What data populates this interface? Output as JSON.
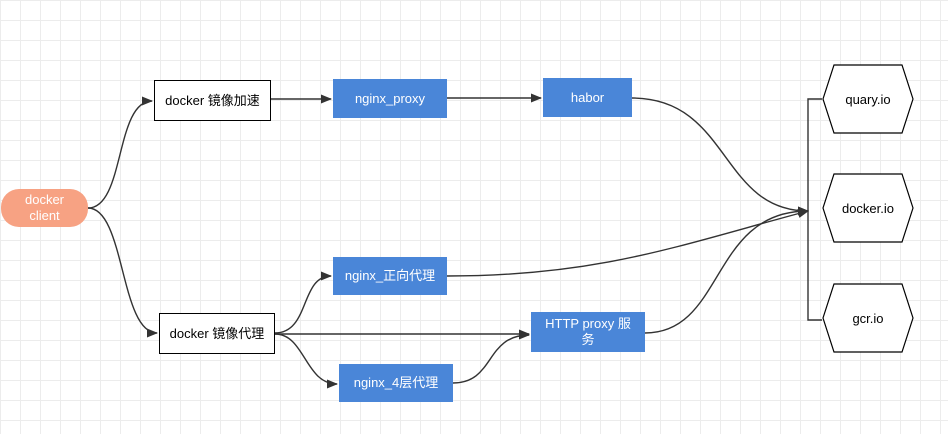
{
  "nodes": {
    "docker_client": "docker\nclient",
    "mirror_accel": "docker 镜像加速",
    "nginx_proxy": "nginx_proxy",
    "habor": "habor",
    "mirror_proxy": "docker 镜像代理",
    "nginx_forward": "nginx_正向代理",
    "http_proxy": "HTTP proxy 服务",
    "nginx_l4": "nginx_4层代理",
    "quay": "quary.io",
    "docker_io": "docker.io",
    "gcr": "gcr.io"
  },
  "colors": {
    "client_fill": "#f7a283",
    "blue_fill": "#4a86d8",
    "edge": "#333333"
  }
}
